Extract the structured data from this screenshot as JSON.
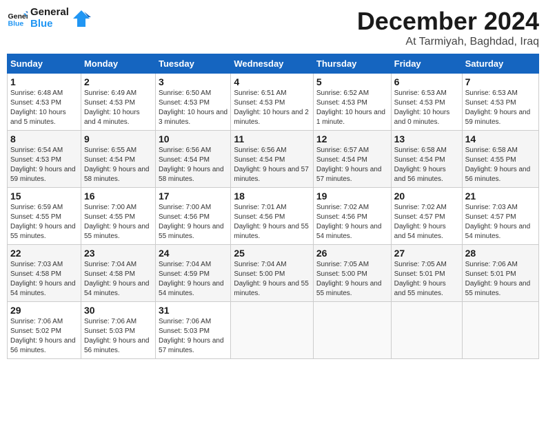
{
  "logo": {
    "general": "General",
    "blue": "Blue"
  },
  "header": {
    "title": "December 2024",
    "subtitle": "At Tarmiyah, Baghdad, Iraq"
  },
  "weekdays": [
    "Sunday",
    "Monday",
    "Tuesday",
    "Wednesday",
    "Thursday",
    "Friday",
    "Saturday"
  ],
  "weeks": [
    [
      {
        "day": "1",
        "sunrise": "6:48 AM",
        "sunset": "4:53 PM",
        "daylight": "10 hours and 5 minutes."
      },
      {
        "day": "2",
        "sunrise": "6:49 AM",
        "sunset": "4:53 PM",
        "daylight": "10 hours and 4 minutes."
      },
      {
        "day": "3",
        "sunrise": "6:50 AM",
        "sunset": "4:53 PM",
        "daylight": "10 hours and 3 minutes."
      },
      {
        "day": "4",
        "sunrise": "6:51 AM",
        "sunset": "4:53 PM",
        "daylight": "10 hours and 2 minutes."
      },
      {
        "day": "5",
        "sunrise": "6:52 AM",
        "sunset": "4:53 PM",
        "daylight": "10 hours and 1 minute."
      },
      {
        "day": "6",
        "sunrise": "6:53 AM",
        "sunset": "4:53 PM",
        "daylight": "10 hours and 0 minutes."
      },
      {
        "day": "7",
        "sunrise": "6:53 AM",
        "sunset": "4:53 PM",
        "daylight": "9 hours and 59 minutes."
      }
    ],
    [
      {
        "day": "8",
        "sunrise": "6:54 AM",
        "sunset": "4:53 PM",
        "daylight": "9 hours and 59 minutes."
      },
      {
        "day": "9",
        "sunrise": "6:55 AM",
        "sunset": "4:54 PM",
        "daylight": "9 hours and 58 minutes."
      },
      {
        "day": "10",
        "sunrise": "6:56 AM",
        "sunset": "4:54 PM",
        "daylight": "9 hours and 58 minutes."
      },
      {
        "day": "11",
        "sunrise": "6:56 AM",
        "sunset": "4:54 PM",
        "daylight": "9 hours and 57 minutes."
      },
      {
        "day": "12",
        "sunrise": "6:57 AM",
        "sunset": "4:54 PM",
        "daylight": "9 hours and 57 minutes."
      },
      {
        "day": "13",
        "sunrise": "6:58 AM",
        "sunset": "4:54 PM",
        "daylight": "9 hours and 56 minutes."
      },
      {
        "day": "14",
        "sunrise": "6:58 AM",
        "sunset": "4:55 PM",
        "daylight": "9 hours and 56 minutes."
      }
    ],
    [
      {
        "day": "15",
        "sunrise": "6:59 AM",
        "sunset": "4:55 PM",
        "daylight": "9 hours and 55 minutes."
      },
      {
        "day": "16",
        "sunrise": "7:00 AM",
        "sunset": "4:55 PM",
        "daylight": "9 hours and 55 minutes."
      },
      {
        "day": "17",
        "sunrise": "7:00 AM",
        "sunset": "4:56 PM",
        "daylight": "9 hours and 55 minutes."
      },
      {
        "day": "18",
        "sunrise": "7:01 AM",
        "sunset": "4:56 PM",
        "daylight": "9 hours and 55 minutes."
      },
      {
        "day": "19",
        "sunrise": "7:02 AM",
        "sunset": "4:56 PM",
        "daylight": "9 hours and 54 minutes."
      },
      {
        "day": "20",
        "sunrise": "7:02 AM",
        "sunset": "4:57 PM",
        "daylight": "9 hours and 54 minutes."
      },
      {
        "day": "21",
        "sunrise": "7:03 AM",
        "sunset": "4:57 PM",
        "daylight": "9 hours and 54 minutes."
      }
    ],
    [
      {
        "day": "22",
        "sunrise": "7:03 AM",
        "sunset": "4:58 PM",
        "daylight": "9 hours and 54 minutes."
      },
      {
        "day": "23",
        "sunrise": "7:04 AM",
        "sunset": "4:58 PM",
        "daylight": "9 hours and 54 minutes."
      },
      {
        "day": "24",
        "sunrise": "7:04 AM",
        "sunset": "4:59 PM",
        "daylight": "9 hours and 54 minutes."
      },
      {
        "day": "25",
        "sunrise": "7:04 AM",
        "sunset": "5:00 PM",
        "daylight": "9 hours and 55 minutes."
      },
      {
        "day": "26",
        "sunrise": "7:05 AM",
        "sunset": "5:00 PM",
        "daylight": "9 hours and 55 minutes."
      },
      {
        "day": "27",
        "sunrise": "7:05 AM",
        "sunset": "5:01 PM",
        "daylight": "9 hours and 55 minutes."
      },
      {
        "day": "28",
        "sunrise": "7:06 AM",
        "sunset": "5:01 PM",
        "daylight": "9 hours and 55 minutes."
      }
    ],
    [
      {
        "day": "29",
        "sunrise": "7:06 AM",
        "sunset": "5:02 PM",
        "daylight": "9 hours and 56 minutes."
      },
      {
        "day": "30",
        "sunrise": "7:06 AM",
        "sunset": "5:03 PM",
        "daylight": "9 hours and 56 minutes."
      },
      {
        "day": "31",
        "sunrise": "7:06 AM",
        "sunset": "5:03 PM",
        "daylight": "9 hours and 57 minutes."
      },
      null,
      null,
      null,
      null
    ]
  ],
  "labels": {
    "sunrise": "Sunrise:",
    "sunset": "Sunset:",
    "daylight": "Daylight:"
  }
}
